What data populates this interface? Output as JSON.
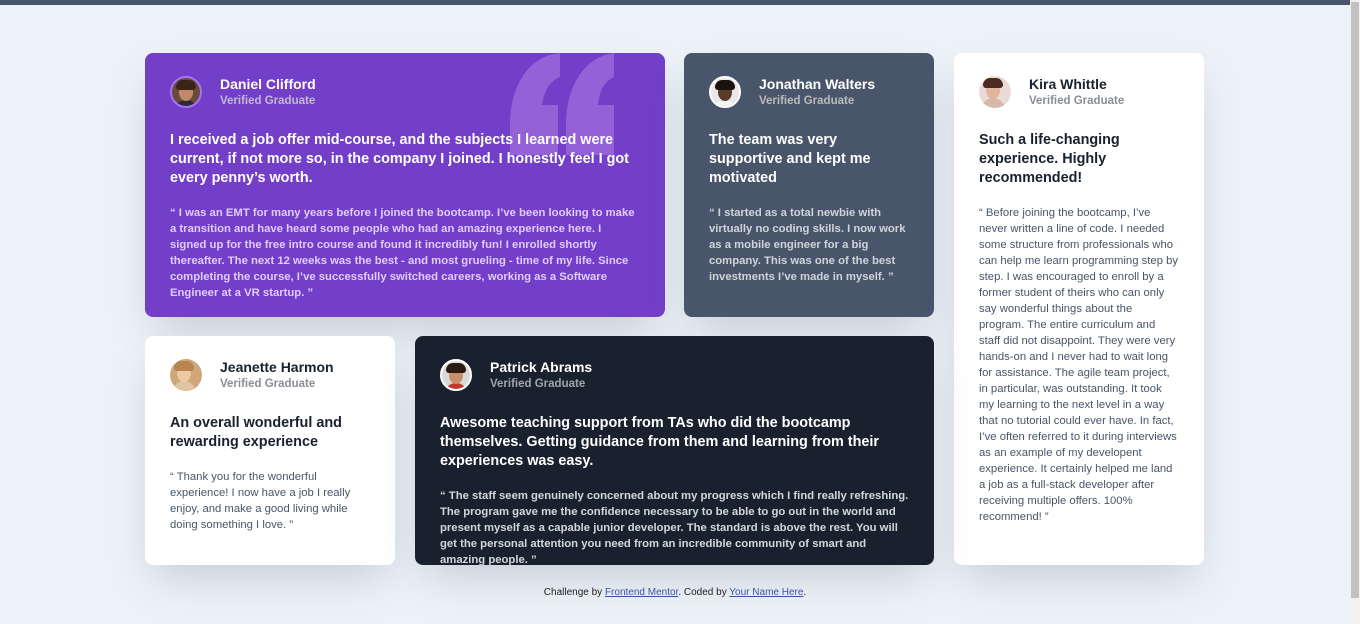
{
  "testimonials": {
    "daniel": {
      "name": "Daniel Clifford",
      "role": "Verified Graduate",
      "title": "I received a job offer mid-course, and the subjects I learned were current, if not more so, in the company I joined. I honestly feel I got every penny’s worth.",
      "quote": "“ I was an EMT for many years before I joined the bootcamp. I’ve been looking to make a transition and have heard some people who had an amazing experience here. I signed up for the free intro course and found it incredibly fun! I enrolled shortly thereafter. The next 12 weeks was the best - and most grueling - time of my life. Since completing the course, I’ve successfully switched careers, working as a Software Engineer at a VR startup. ”"
    },
    "jonathan": {
      "name": "Jonathan Walters",
      "role": "Verified Graduate",
      "title": "The team was very supportive and kept me motivated",
      "quote": "“ I started as a total newbie with virtually no coding skills. I now work as a mobile engineer for a big company. This was one of the best investments I’ve made in myself. ”"
    },
    "kira": {
      "name": "Kira Whittle",
      "role": "Verified Graduate",
      "title": "Such a life-changing experience. Highly recommended!",
      "quote": "“ Before joining the bootcamp, I’ve never written a line of code. I needed some structure from professionals who can help me learn programming step by step. I was encouraged to enroll by a former student of theirs who can only say wonderful things about the program. The entire curriculum and staff did not disappoint. They were very hands-on and I never had to wait long for assistance. The agile team project, in particular, was outstanding. It took my learning to the next level in a way that no tutorial could ever have. In fact, I’ve often referred to it during interviews as an example of my developent experience. It certainly helped me land a job as a full-stack developer after receiving multiple offers. 100% recommend! ”"
    },
    "jeanette": {
      "name": "Jeanette Harmon",
      "role": "Verified Graduate",
      "title": "An overall wonderful and rewarding experience",
      "quote": "“ Thank you for the wonderful experience! I now have a job I really enjoy, and make a good living while doing something I love. ”"
    },
    "patrick": {
      "name": "Patrick Abrams",
      "role": "Verified Graduate",
      "title": "Awesome teaching support from TAs who did the bootcamp themselves. Getting guidance from them and learning from their experiences was easy.",
      "quote": "“ The staff seem genuinely concerned about my progress which I find really refreshing. The program gave me the confidence necessary to be able to go out in the world and present myself as a capable junior developer. The standard is above the rest. You will get the personal attention you need from an incredible community of smart and amazing people. ”"
    }
  },
  "footer": {
    "prefix": "Challenge by ",
    "link1": "Frontend Mentor",
    "middle": ". Coded by ",
    "link2": "Your Name Here",
    "suffix": "."
  },
  "colors": {
    "purple": "#733fc8",
    "grayish_blue": "#48556a",
    "dark_blackish_blue": "#19212e",
    "background": "#edf2f8"
  },
  "icons": [
    "quotation-mark-icon",
    "avatar-photo"
  ]
}
